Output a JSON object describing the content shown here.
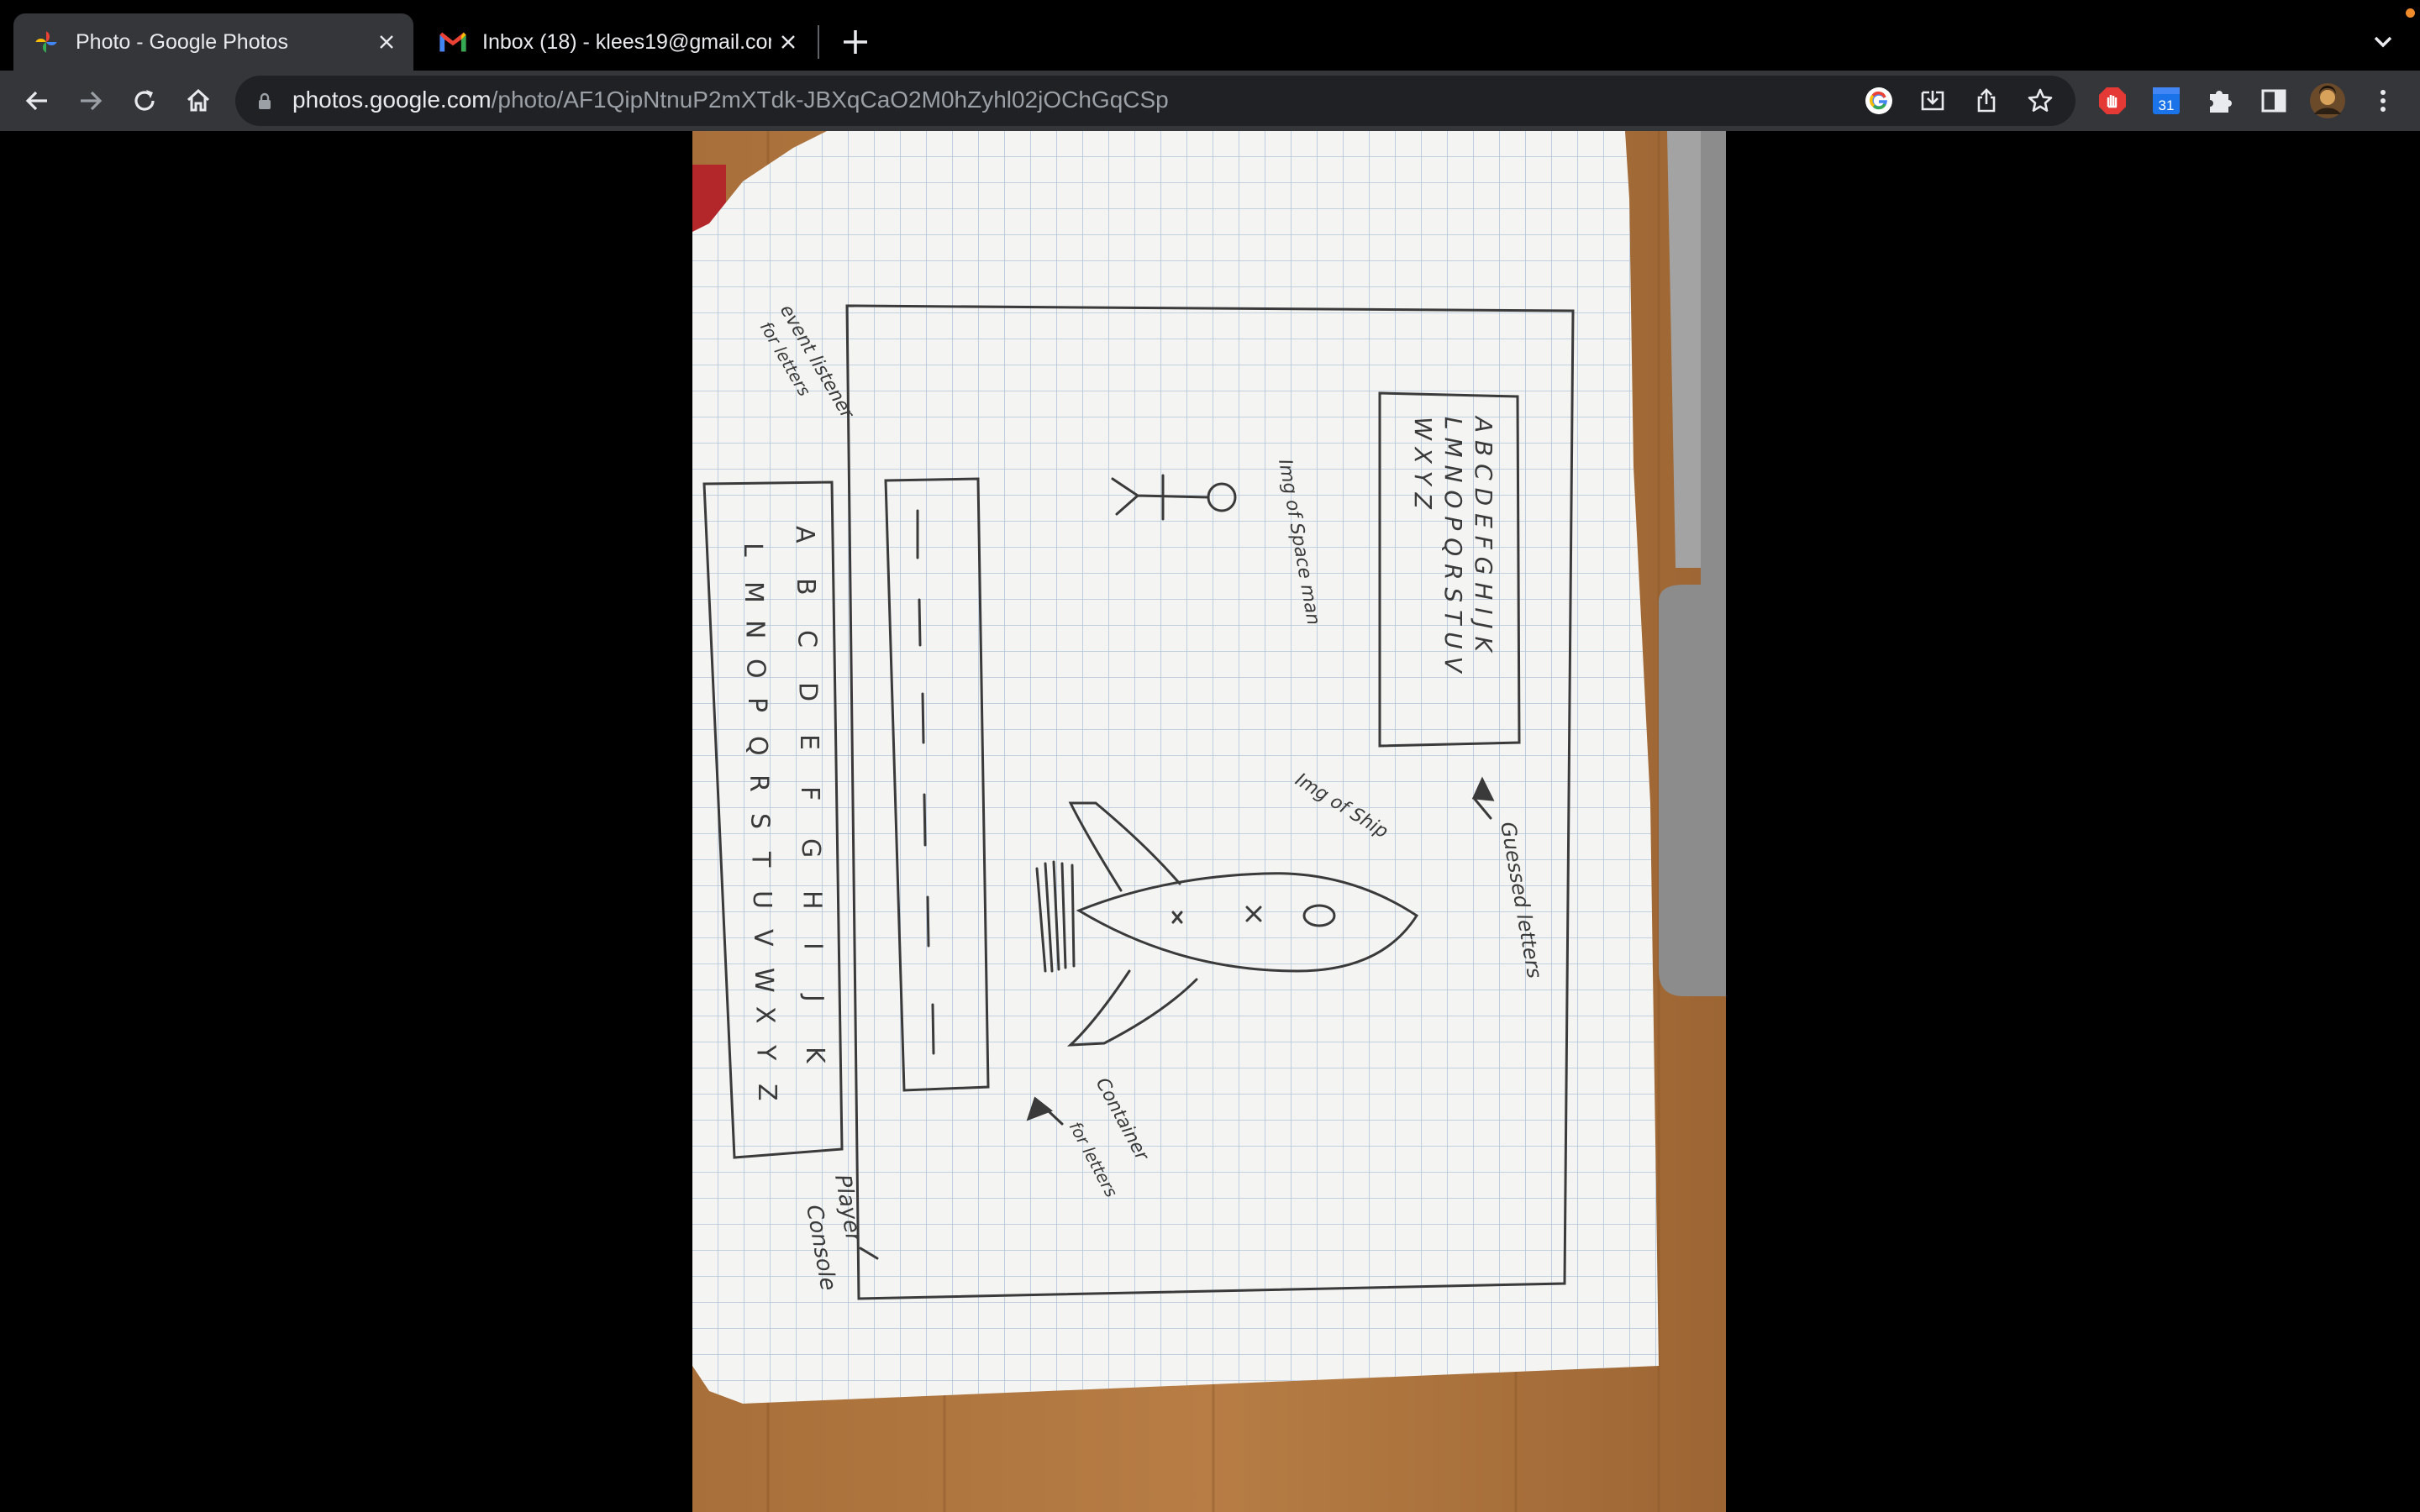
{
  "tabs": [
    {
      "title": "Photo - Google Photos",
      "favicon": "google-photos-icon",
      "active": true
    },
    {
      "title": "Inbox (18) - klees19@gmail.com",
      "favicon": "gmail-icon",
      "active": false
    }
  ],
  "address_bar": {
    "host": "photos.google.com",
    "path": "/photo/AF1QipNtnuP2mXTdk-JBXqCaO2M0hZyhl02jOChGqCSp"
  },
  "toolbar_icons": [
    "back-icon",
    "forward-icon",
    "reload-icon",
    "home-icon",
    "google-lens-icon",
    "install-app-icon",
    "share-icon",
    "bookmark-star-icon",
    "adblock-icon",
    "calendar-extension-icon",
    "extensions-puzzle-icon",
    "side-panel-icon",
    "profile-avatar",
    "more-menu-icon"
  ],
  "calendar_badge": "31",
  "colors": {
    "tab_active": "#35363a",
    "toolbar": "#35363a",
    "omnibox": "#202124",
    "page_bg": "#000000",
    "text": "#e8eaed",
    "muted": "#9aa0a6"
  },
  "photo": {
    "sketch_labels": {
      "event_listener": [
        "event listener",
        "for letters"
      ],
      "img_spaceman": "Img of Space man",
      "img_ship": "Img of Ship",
      "guessed_letters": "Guessed letters",
      "container_letters": [
        "Container",
        "for letters"
      ],
      "player_console": [
        "Player",
        "Console"
      ],
      "top_alpha": [
        "A B C D E F G H I J K",
        "L M N O P Q R S T U V",
        "W X Y Z"
      ],
      "left_alpha": [
        "A",
        "B",
        "C",
        "D",
        "E",
        "F",
        "G",
        "H",
        "I",
        "J",
        "K"
      ],
      "left_alpha2": [
        "L",
        "M",
        "N",
        "O",
        "P",
        "Q",
        "R",
        "S",
        "T",
        "U",
        "V",
        "W",
        "X",
        "Y",
        "Z"
      ]
    }
  }
}
